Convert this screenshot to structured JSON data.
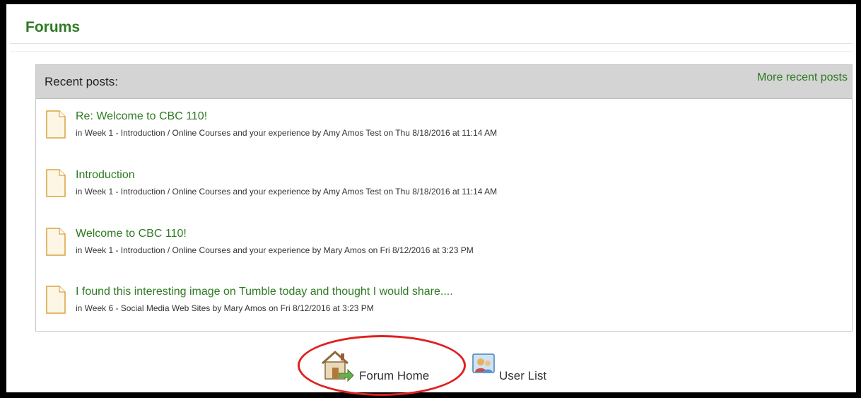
{
  "page": {
    "title": "Forums"
  },
  "recent": {
    "header": "Recent posts:",
    "more_link": "More recent posts",
    "posts": [
      {
        "title": "Re: Welcome to CBC 110!",
        "meta": "in  Week 1 - Introduction / Online Courses and your experience by Amy Amos Test  on Thu 8/18/2016 at 11:14 AM"
      },
      {
        "title": "Introduction",
        "meta": "in  Week 1 - Introduction / Online Courses and your experience by Amy Amos Test  on Thu 8/18/2016 at 11:14 AM"
      },
      {
        "title": "Welcome to CBC 110!",
        "meta": "in  Week 1 - Introduction / Online Courses and your experience by Mary Amos  on Fri 8/12/2016 at 3:23 PM"
      },
      {
        "title": "I found this interesting image on Tumble today and thought I would share....",
        "meta": "in  Week 6 - Social Media Web Sites by Mary Amos  on Fri 8/12/2016 at 3:23 PM"
      }
    ]
  },
  "footer": {
    "forum_home": "Forum Home",
    "user_list": "User List"
  },
  "colors": {
    "accent_green": "#2f7a23",
    "header_gray": "#d4d4d4",
    "highlight_red": "#e02020"
  }
}
